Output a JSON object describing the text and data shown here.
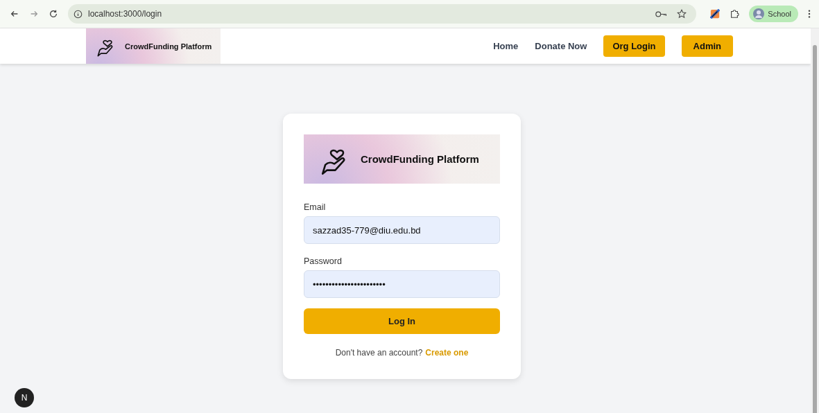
{
  "browser": {
    "url": "localhost:3000/login",
    "profile": "School"
  },
  "nav": {
    "logo_text": "CrowdFunding Platform",
    "links": [
      "Home",
      "Donate Now"
    ],
    "buttons": [
      "Org Login",
      "Admin"
    ]
  },
  "login": {
    "logo_text": "CrowdFunding Platform",
    "fields": [
      {
        "label": "Email",
        "value": "sazzad35-779@diu.edu.bd"
      },
      {
        "label": "Password",
        "value": "•••••••••••••••••••••••"
      }
    ],
    "submit": "Log In",
    "signup_prompt": "Don't have an account?",
    "signup_link": "Create one"
  },
  "dev_badge": "N"
}
